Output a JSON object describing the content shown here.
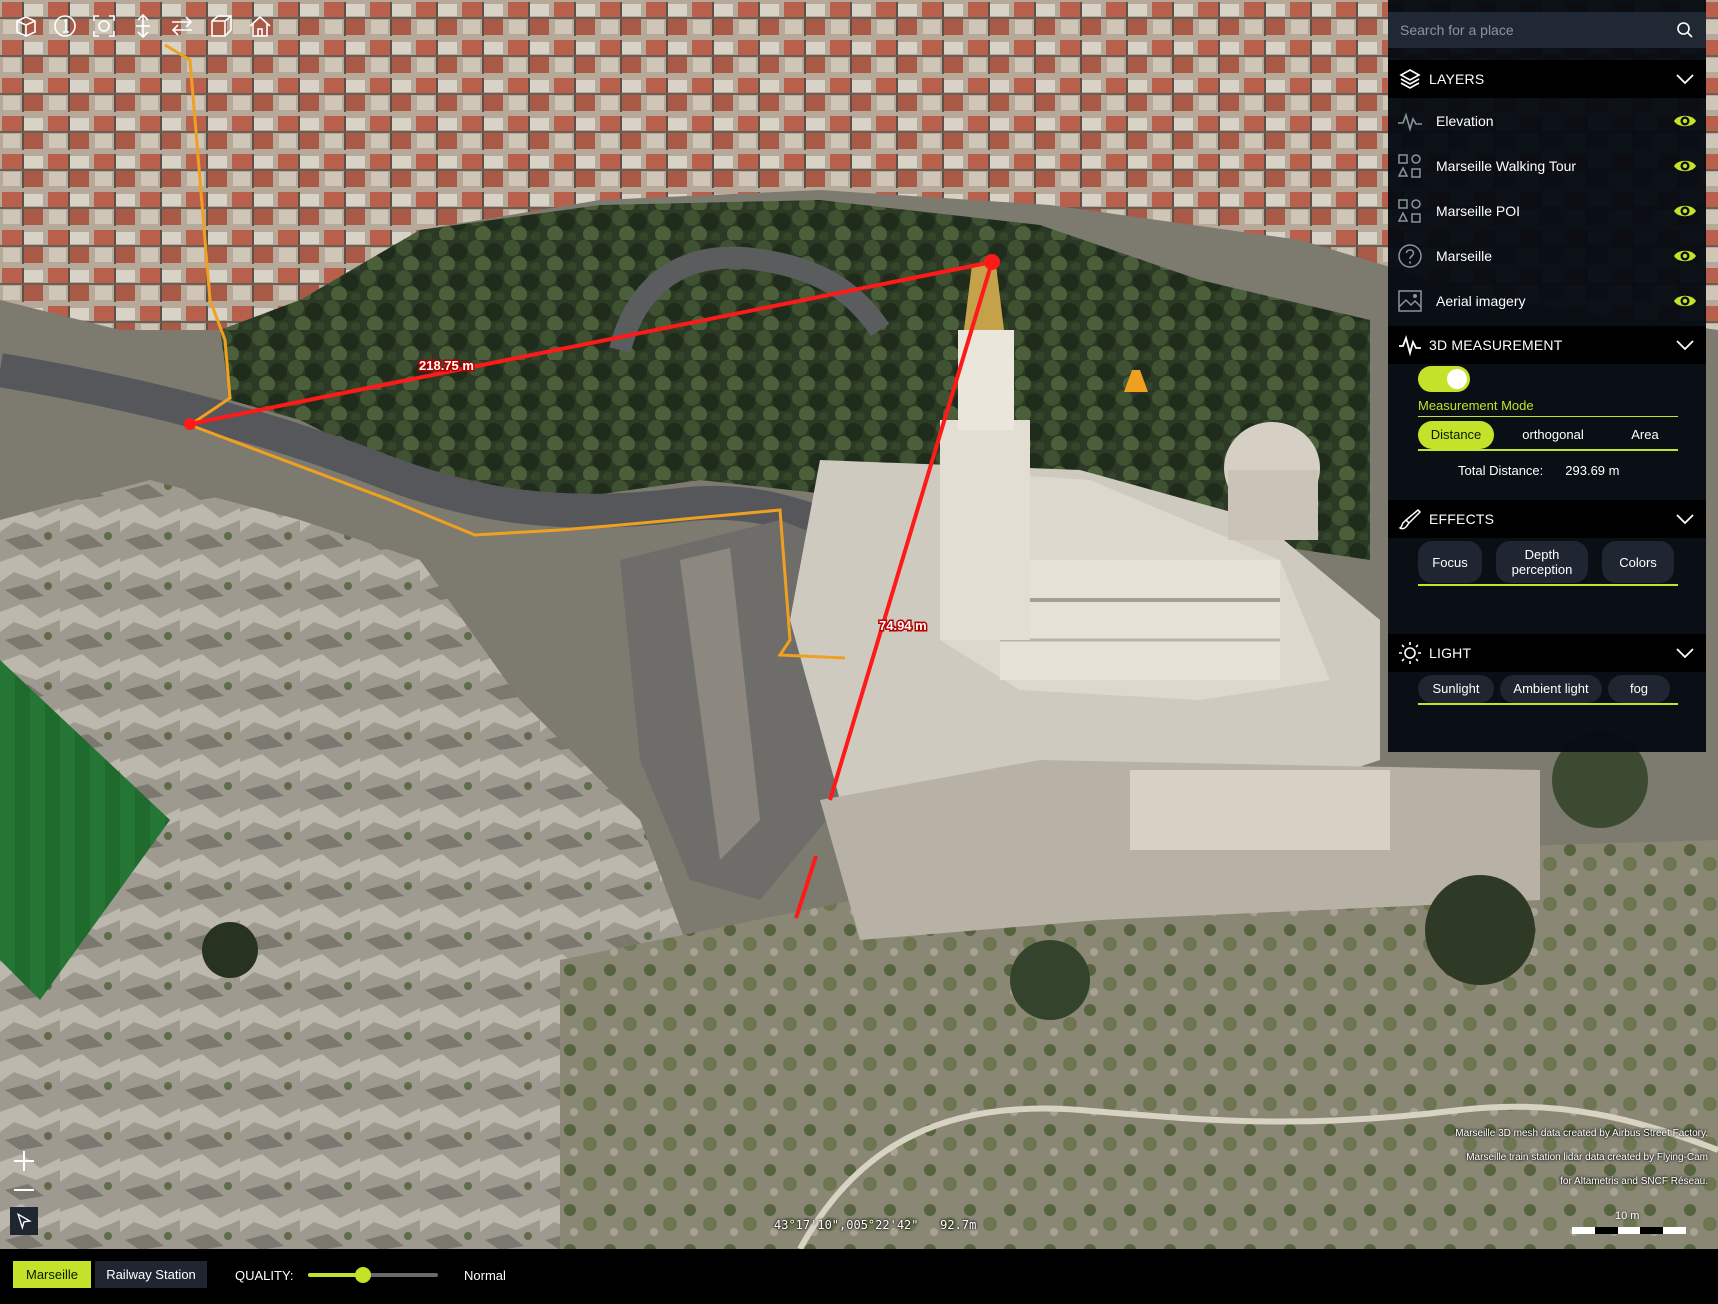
{
  "toolbar": {
    "tools": [
      {
        "name": "perspective-view-icon"
      },
      {
        "name": "orientation-reset-icon"
      },
      {
        "name": "screenshot-icon"
      },
      {
        "name": "vertical-move-icon"
      },
      {
        "name": "swap-view-icon"
      },
      {
        "name": "cube-view-icon"
      },
      {
        "name": "home-view-icon"
      }
    ]
  },
  "search": {
    "placeholder": "Search for a place",
    "icon": "search-icon"
  },
  "layers": {
    "title": "LAYERS",
    "items": [
      {
        "label": "Elevation",
        "icon": "elevation-icon",
        "visible": true
      },
      {
        "label": "Marseille Walking Tour",
        "icon": "vector-layer-icon",
        "visible": true
      },
      {
        "label": "Marseille POI",
        "icon": "vector-layer-icon",
        "visible": true
      },
      {
        "label": "Marseille",
        "icon": "unknown-layer-icon",
        "visible": true
      },
      {
        "label": "Aerial imagery",
        "icon": "imagery-icon",
        "visible": true
      }
    ]
  },
  "measurement": {
    "title": "3D MEASUREMENT",
    "enabled": true,
    "mode_label": "Measurement Mode",
    "modes": [
      "Distance",
      "orthogonal",
      "Area"
    ],
    "active_mode": "Distance",
    "total_label": "Total Distance:",
    "total_value": "293.69 m",
    "segment_labels": [
      "218.75 m",
      "74.94 m"
    ]
  },
  "effects": {
    "title": "EFFECTS",
    "buttons": [
      "Focus",
      "Depth perception",
      "Colors"
    ]
  },
  "light": {
    "title": "LIGHT",
    "buttons": [
      "Sunlight",
      "Ambient light",
      "fog"
    ]
  },
  "zoom": {
    "in_icon": "zoom-in-icon",
    "out_icon": "zoom-out-icon",
    "compass_icon": "compass-icon"
  },
  "status": {
    "coordinates": "43°17'10\",005°22'42\"   92.7m",
    "scale_label": "10 m"
  },
  "attribution": [
    "Marseille 3D mesh data created by Airbus Street Factory.",
    "Marseille train station lidar data created by Flying-Cam",
    "for Altametris and SNCF Réseau."
  ],
  "bottombar": {
    "projects": [
      "Marseille",
      "Railway Station"
    ],
    "active_project": "Marseille",
    "quality_label": "QUALITY:",
    "quality_level": 0.42,
    "quality_value": "Normal"
  },
  "colors": {
    "accent": "#c3e229",
    "panel": "#060b13",
    "measure_line": "#ff1a1a",
    "walking_path": "#f0a020"
  }
}
